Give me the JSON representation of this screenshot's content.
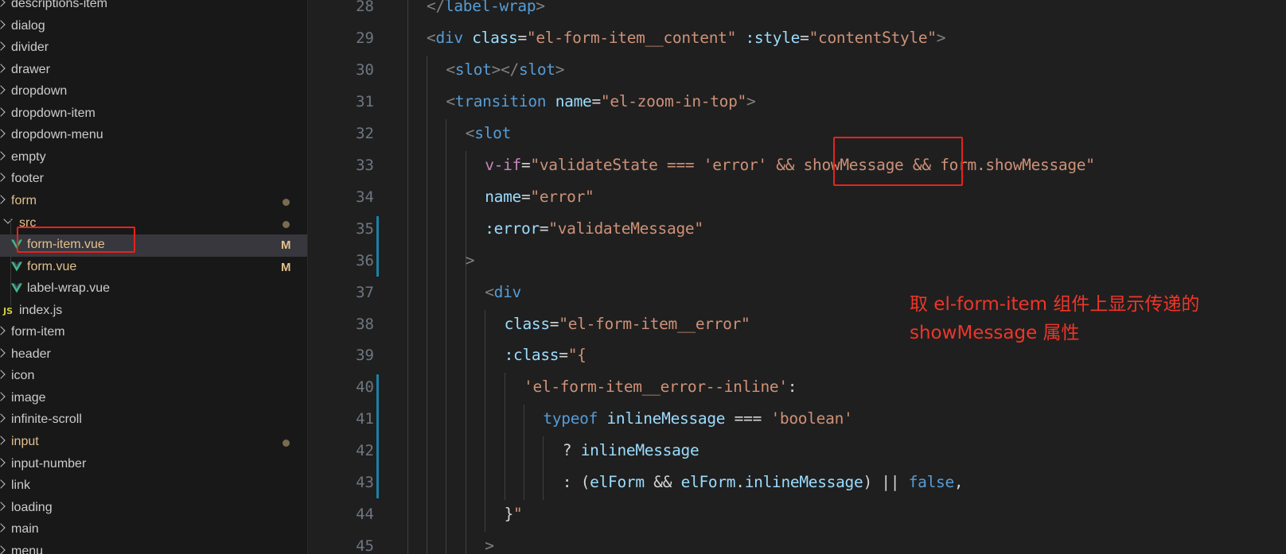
{
  "explorer": {
    "items": [
      {
        "label": "descriptions-item",
        "kind": "folder",
        "state": "collapsed"
      },
      {
        "label": "dialog",
        "kind": "folder",
        "state": "collapsed"
      },
      {
        "label": "divider",
        "kind": "folder",
        "state": "collapsed"
      },
      {
        "label": "drawer",
        "kind": "folder",
        "state": "collapsed"
      },
      {
        "label": "dropdown",
        "kind": "folder",
        "state": "collapsed"
      },
      {
        "label": "dropdown-item",
        "kind": "folder",
        "state": "collapsed"
      },
      {
        "label": "dropdown-menu",
        "kind": "folder",
        "state": "collapsed"
      },
      {
        "label": "empty",
        "kind": "folder",
        "state": "collapsed"
      },
      {
        "label": "footer",
        "kind": "folder",
        "state": "collapsed"
      },
      {
        "label": "form",
        "kind": "folder",
        "state": "collapsed",
        "modified": true
      },
      {
        "label": "src",
        "kind": "folder",
        "state": "expanded",
        "modified": true
      },
      {
        "label": "form-item.vue",
        "kind": "vue-file",
        "badge": "M",
        "selected": true
      },
      {
        "label": "form.vue",
        "kind": "vue-file",
        "badge": "M"
      },
      {
        "label": "label-wrap.vue",
        "kind": "vue-file"
      },
      {
        "label": "index.js",
        "kind": "js-file"
      },
      {
        "label": "form-item",
        "kind": "folder",
        "state": "collapsed"
      },
      {
        "label": "header",
        "kind": "folder",
        "state": "collapsed"
      },
      {
        "label": "icon",
        "kind": "folder",
        "state": "collapsed"
      },
      {
        "label": "image",
        "kind": "folder",
        "state": "collapsed"
      },
      {
        "label": "infinite-scroll",
        "kind": "folder",
        "state": "collapsed"
      },
      {
        "label": "input",
        "kind": "folder",
        "state": "collapsed",
        "modified": true
      },
      {
        "label": "input-number",
        "kind": "folder",
        "state": "collapsed"
      },
      {
        "label": "link",
        "kind": "folder",
        "state": "collapsed"
      },
      {
        "label": "loading",
        "kind": "folder",
        "state": "collapsed"
      },
      {
        "label": "main",
        "kind": "folder",
        "state": "collapsed"
      },
      {
        "label": "menu",
        "kind": "folder",
        "state": "collapsed"
      }
    ]
  },
  "editor": {
    "lines": [
      {
        "num": "28",
        "text": "</label-wrap>"
      },
      {
        "num": "29",
        "text": "<div class=\"el-form-item__content\" :style=\"contentStyle\">"
      },
      {
        "num": "30",
        "text": "<slot></slot>"
      },
      {
        "num": "31",
        "text": "<transition name=\"el-zoom-in-top\">"
      },
      {
        "num": "32",
        "text": "<slot"
      },
      {
        "num": "33",
        "text": "v-if=\"validateState === 'error' && showMessage && form.showMessage\""
      },
      {
        "num": "34",
        "text": "name=\"error\""
      },
      {
        "num": "35",
        "text": ":error=\"validateMessage\""
      },
      {
        "num": "36",
        "text": ">"
      },
      {
        "num": "37",
        "text": "<div"
      },
      {
        "num": "38",
        "text": "class=\"el-form-item__error\""
      },
      {
        "num": "39",
        "text": ":class=\"{"
      },
      {
        "num": "40",
        "text": "'el-form-item__error--inline':"
      },
      {
        "num": "41",
        "text": "typeof inlineMessage === 'boolean'"
      },
      {
        "num": "42",
        "text": "? inlineMessage"
      },
      {
        "num": "43",
        "text": ": (elForm && elForm.inlineMessage) || false,"
      },
      {
        "num": "44",
        "text": "}\""
      },
      {
        "num": "45",
        "text": ">"
      }
    ]
  },
  "annotation": {
    "line1": "取 el-form-item 组件上显示传递的",
    "line2": "showMessage 属性",
    "color": "#e8221d"
  },
  "colors": {
    "sidebar_bg": "#181818",
    "editor_bg": "#1f1f1f",
    "modified_text": "#e2c08d",
    "tag": "#569cd6",
    "attr": "#9cdcfe",
    "string": "#ce9178",
    "directive": "#c586c0"
  }
}
